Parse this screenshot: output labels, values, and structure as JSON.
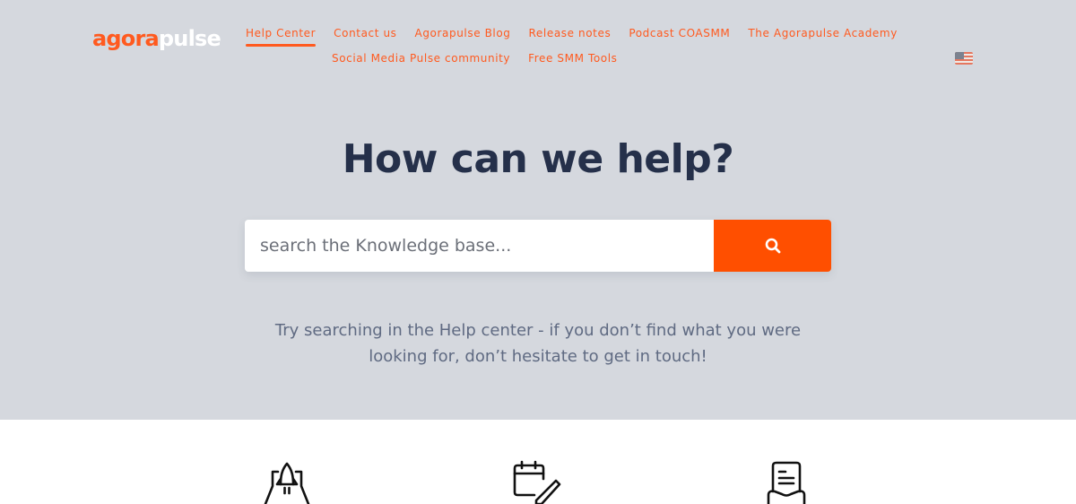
{
  "brand": {
    "logo_part1": "agora",
    "logo_part2": "pulse",
    "accent_color": "#ff5a1f"
  },
  "nav": {
    "row1": [
      {
        "label": "Help Center",
        "active": true
      },
      {
        "label": "Contact us"
      },
      {
        "label": "Agorapulse Blog"
      },
      {
        "label": "Release notes"
      },
      {
        "label": "Podcast COASMM"
      },
      {
        "label": "The Agorapulse Academy"
      }
    ],
    "row2": [
      {
        "label": "Social Media Pulse community"
      },
      {
        "label": "Free SMM Tools"
      }
    ],
    "language_icon": "us-flag-icon"
  },
  "hero": {
    "title": "How can we help?",
    "search": {
      "placeholder": "search the Knowledge base...",
      "value": "",
      "button_icon": "search-icon"
    },
    "subtitle_line1": "Try searching in the Help center - if you don’t find what you were",
    "subtitle_line2": "looking for, don’t hesitate to get in touch!"
  },
  "categories": [
    {
      "icon": "rocket-launch-icon"
    },
    {
      "icon": "calendar-edit-icon"
    },
    {
      "icon": "document-inbox-icon"
    }
  ]
}
